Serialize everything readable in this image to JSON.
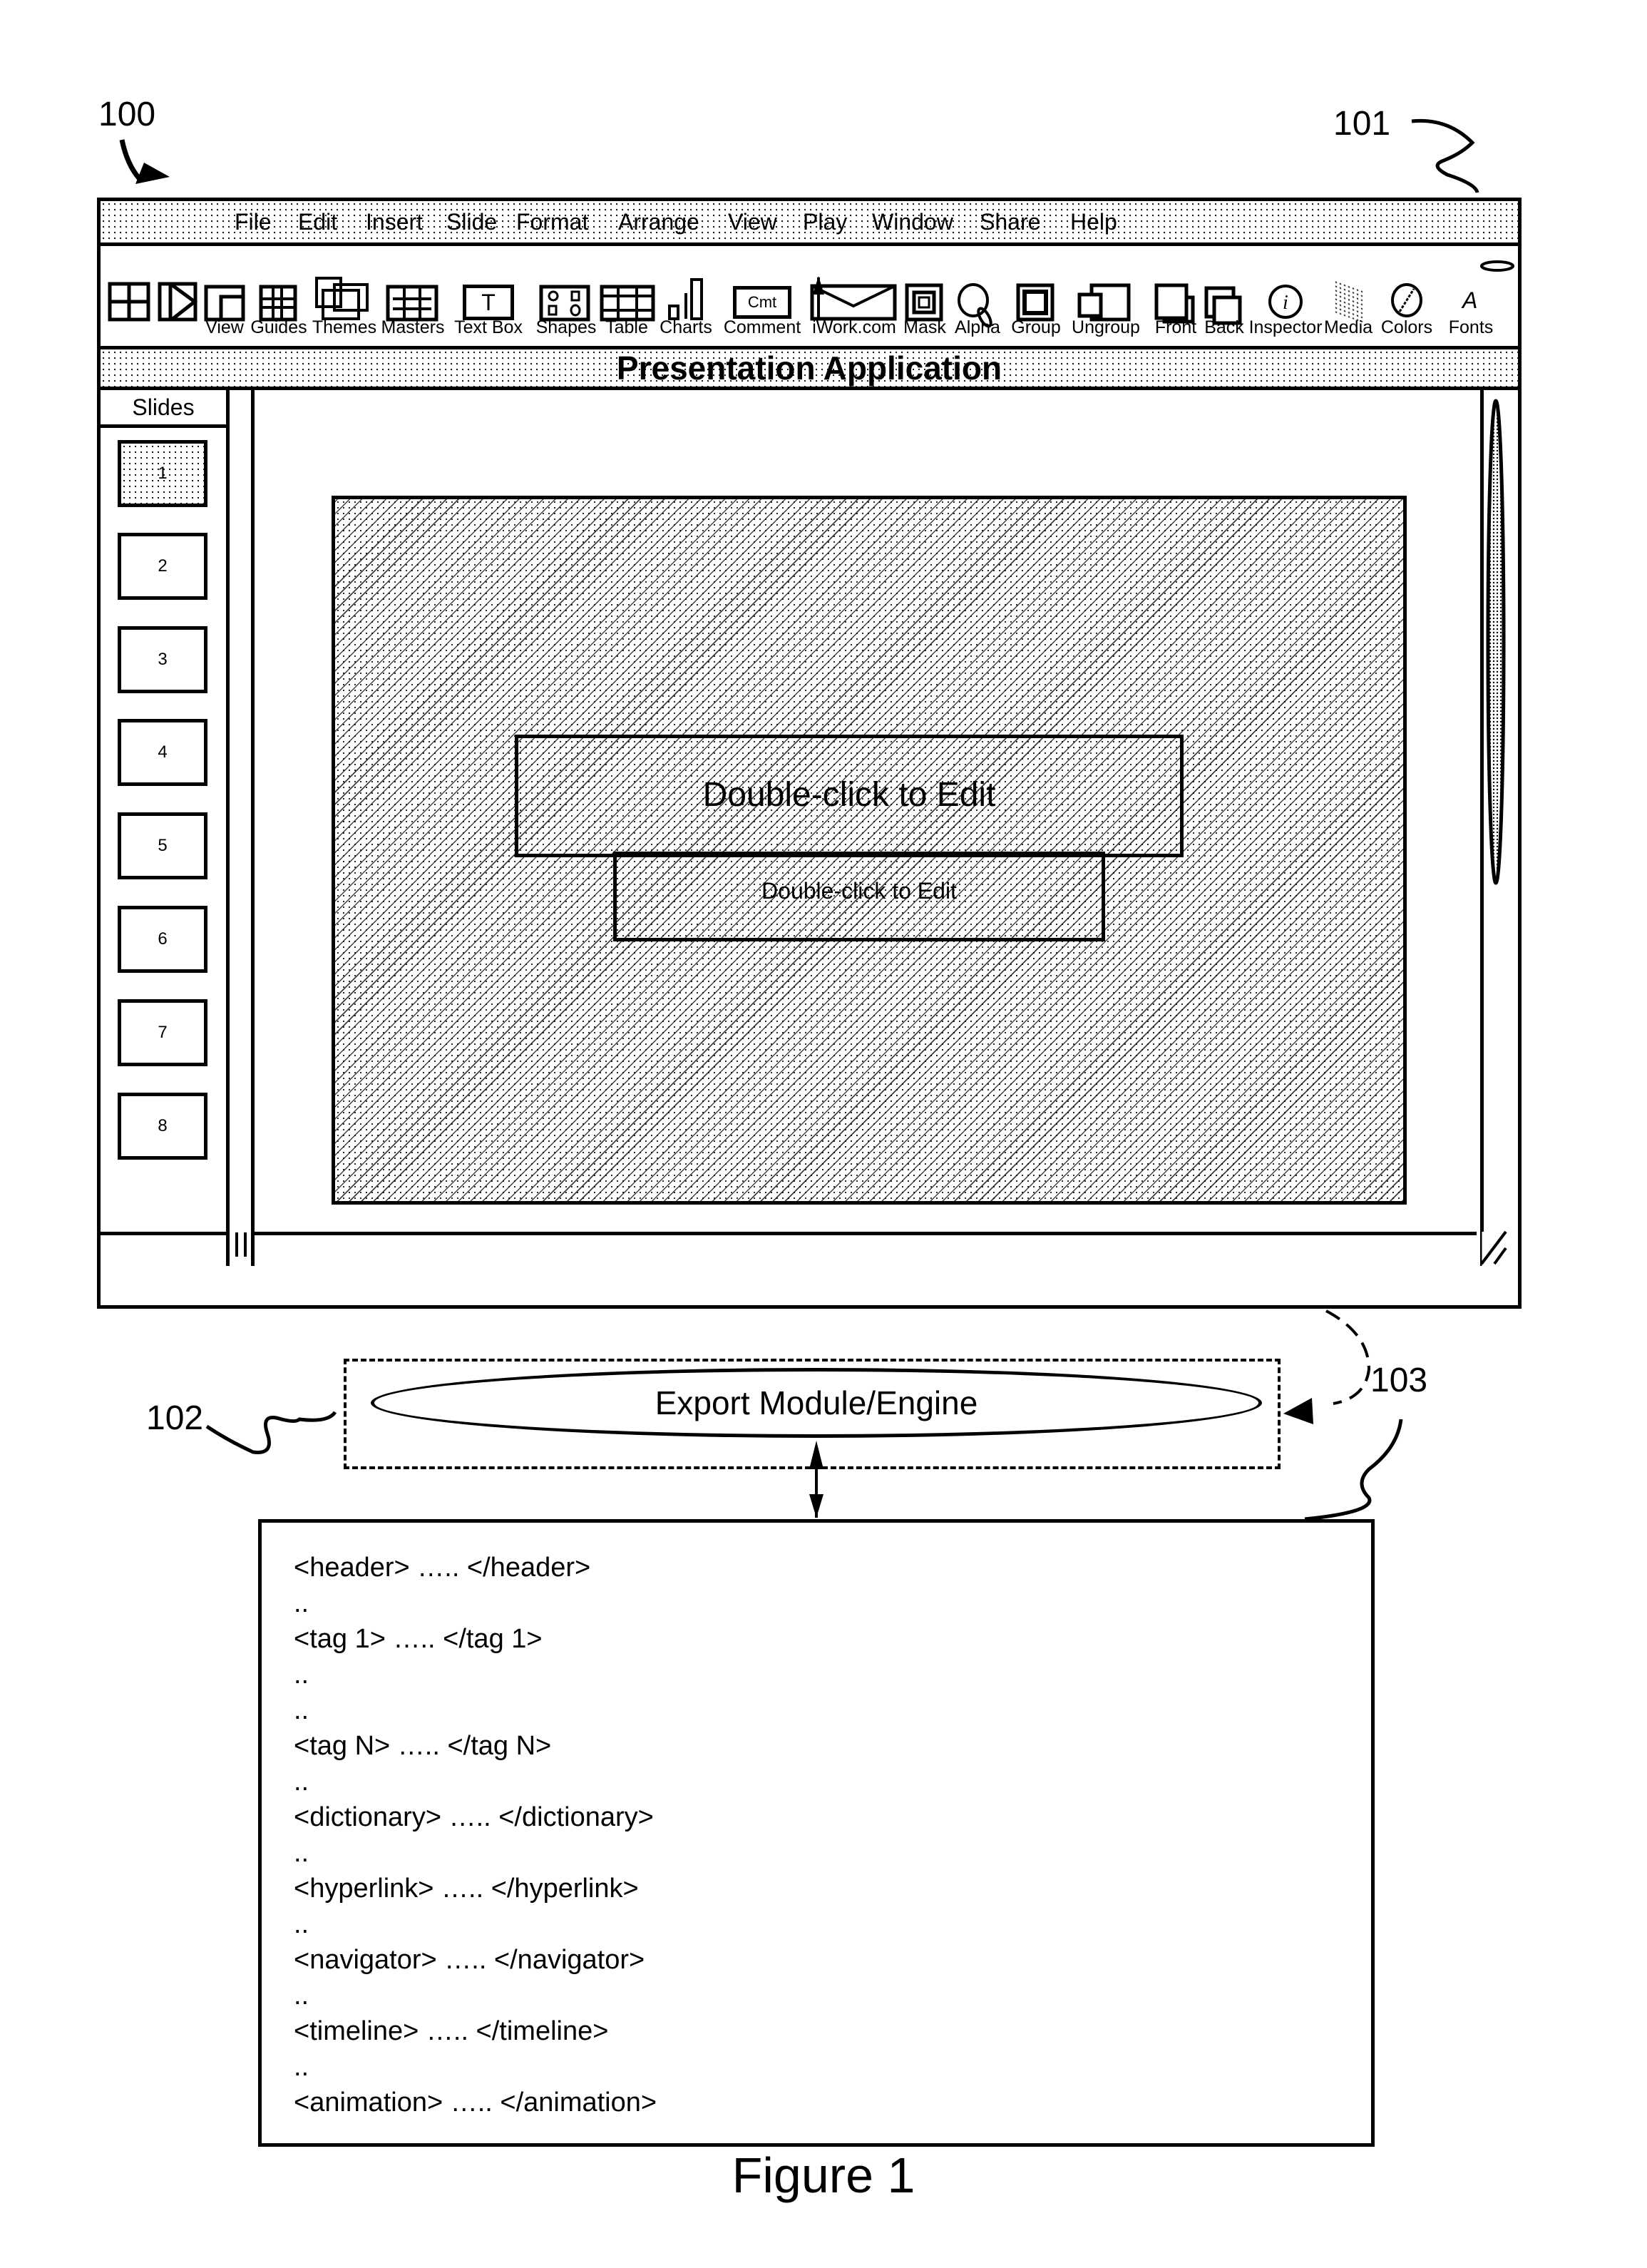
{
  "figure": {
    "caption": "Figure 1",
    "ref_labels": {
      "system": "100",
      "window": "101",
      "export_module": "102",
      "export_file": "103"
    }
  },
  "app": {
    "menu": [
      "File",
      "Edit",
      "Insert",
      "Slide",
      "Format",
      "Arrange",
      "View",
      "Play",
      "Window",
      "Share",
      "Help"
    ],
    "toolbar": [
      {
        "icon": "layout-grid-icon",
        "label": ""
      },
      {
        "icon": "play-slideshow-icon",
        "label": ""
      },
      {
        "icon": "view-icon",
        "label": "View"
      },
      {
        "icon": "guides-icon",
        "label": "Guides"
      },
      {
        "icon": "themes-icon",
        "label": "Themes"
      },
      {
        "icon": "masters-icon",
        "label": "Masters"
      },
      {
        "icon": "text-box-icon",
        "label": "Text Box",
        "glyph": "T"
      },
      {
        "icon": "shapes-icon",
        "label": "Shapes"
      },
      {
        "icon": "table-icon",
        "label": "Table"
      },
      {
        "icon": "charts-icon",
        "label": "Charts"
      },
      {
        "icon": "comment-icon",
        "label": "Comment",
        "glyph": "Cmt"
      },
      {
        "icon": "iwork-share-icon",
        "label": "iWork.com"
      },
      {
        "icon": "mask-icon",
        "label": "Mask"
      },
      {
        "icon": "alpha-icon",
        "label": "Alpha"
      },
      {
        "icon": "group-icon",
        "label": "Group"
      },
      {
        "icon": "ungroup-icon",
        "label": "Ungroup"
      },
      {
        "icon": "bring-front-icon",
        "label": "Front"
      },
      {
        "icon": "send-back-icon",
        "label": "Back"
      },
      {
        "icon": "inspector-icon",
        "label": "Inspector",
        "glyph": "i"
      },
      {
        "icon": "media-icon",
        "label": "Media"
      },
      {
        "icon": "colors-icon",
        "label": "Colors"
      },
      {
        "icon": "fonts-icon",
        "label": "Fonts",
        "glyph": "A"
      }
    ],
    "title": "Presentation Application",
    "slides_panel": {
      "header": "Slides",
      "slides": [
        "1",
        "2",
        "3",
        "4",
        "5",
        "6",
        "7",
        "8"
      ],
      "selected": "1"
    },
    "slide": {
      "title_placeholder": "Double-click to Edit",
      "subtitle_placeholder": "Double-click to Edit"
    }
  },
  "export_module": {
    "label": "Export Module/Engine"
  },
  "export_file": {
    "lines": [
      "<header> ….. </header>",
      "..",
      "<tag 1> ….. </tag 1>",
      "..",
      "..",
      "<tag N> ….. </tag N>",
      "..",
      "<dictionary> ….. </dictionary>",
      "..",
      "<hyperlink> ….. </hyperlink>",
      "..",
      "<navigator> ….. </navigator>",
      "..",
      "<timeline> ….. </timeline>",
      "..",
      "<animation> ….. </animation>"
    ]
  }
}
